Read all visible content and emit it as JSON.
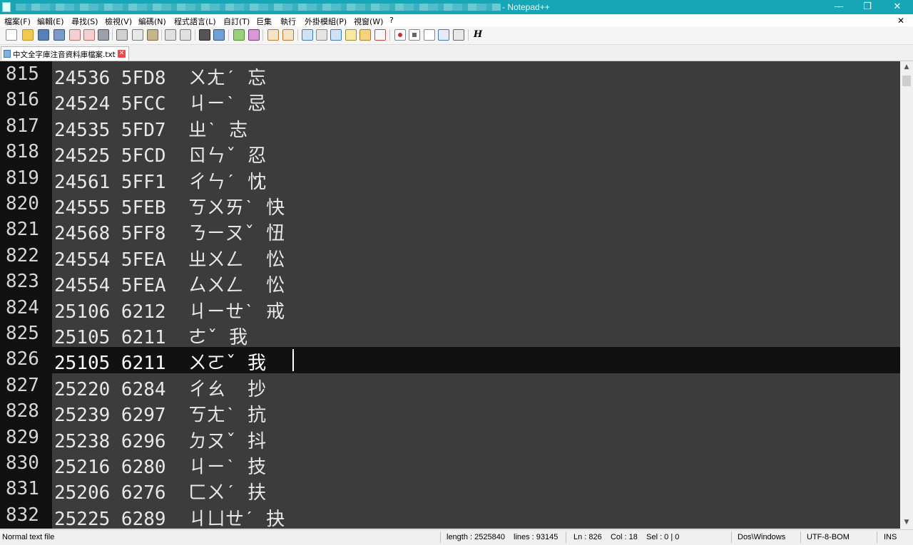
{
  "window": {
    "title": "- Notepad++",
    "minimize_glyph": "—",
    "restore_glyph": "❐",
    "close_glyph": "✕",
    "menu_close_glyph": "✕"
  },
  "menu": [
    "檔案(F)",
    "編輯(E)",
    "尋找(S)",
    "檢視(V)",
    "編碼(N)",
    "程式語言(L)",
    "自訂(T)",
    "巨集",
    "執行",
    "外掛模組(P)",
    "視窗(W)",
    "?"
  ],
  "toolbar": {
    "icons": [
      "new-file-icon",
      "open-file-icon",
      "save-icon",
      "save-all-icon",
      "close-icon",
      "close-all-icon",
      "print-icon",
      "cut-icon",
      "copy-icon",
      "paste-icon",
      "undo-icon",
      "redo-icon",
      "find-icon",
      "replace-icon",
      "zoom-in-icon",
      "zoom-out-icon",
      "sync-vertical-icon",
      "sync-horizontal-icon",
      "word-wrap-icon",
      "show-all-chars-icon",
      "indent-guide-icon",
      "doc-map-icon",
      "function-list-icon",
      "folder-workspace-icon",
      "record-macro-icon",
      "stop-macro-icon",
      "play-macro-icon",
      "run-macro-multiple-icon",
      "save-macro-icon",
      "h-icon"
    ],
    "h_glyph": "H"
  },
  "tab": {
    "label": "中文全字庫注音資料庫檔案.txt",
    "close_glyph": "✕"
  },
  "editor": {
    "current_line": 826,
    "lines": [
      {
        "num": "815",
        "text": "24536 5FD8  ㄨㄤˊ 忘"
      },
      {
        "num": "816",
        "text": "24524 5FCC  ㄐㄧˋ 忌"
      },
      {
        "num": "817",
        "text": "24535 5FD7  ㄓˋ 志"
      },
      {
        "num": "818",
        "text": "24525 5FCD  ㄖㄣˇ 忍"
      },
      {
        "num": "819",
        "text": "24561 5FF1  ㄔㄣˊ 忱"
      },
      {
        "num": "820",
        "text": "24555 5FEB  ㄎㄨㄞˋ 快"
      },
      {
        "num": "821",
        "text": "24568 5FF8  ㄋㄧㄡˇ 忸"
      },
      {
        "num": "822",
        "text": "24554 5FEA  ㄓㄨㄥ  忪"
      },
      {
        "num": "823",
        "text": "24554 5FEA  ㄙㄨㄥ  忪"
      },
      {
        "num": "824",
        "text": "25106 6212  ㄐㄧㄝˋ 戒"
      },
      {
        "num": "825",
        "text": "25105 6211  ㄜˇ 我"
      },
      {
        "num": "826",
        "text": "25105 6211  ㄨㄛˇ 我"
      },
      {
        "num": "827",
        "text": "25220 6284  ㄔㄠ  抄"
      },
      {
        "num": "828",
        "text": "25239 6297  ㄎㄤˋ 抗"
      },
      {
        "num": "829",
        "text": "25238 6296  ㄉㄡˇ 抖"
      },
      {
        "num": "830",
        "text": "25216 6280  ㄐㄧˋ 技"
      },
      {
        "num": "831",
        "text": "25206 6276  ㄈㄨˊ 扶"
      },
      {
        "num": "832",
        "text": "25225 6289  ㄐㄩㄝˊ 抉"
      }
    ]
  },
  "status": {
    "file_type": "Normal text file",
    "length": "length : 2525840",
    "lines": "lines : 93145",
    "position": "Ln : 826    Col : 18    Sel : 0 | 0",
    "eol": "Dos\\Windows",
    "encoding": "UTF-8-BOM",
    "mode": "INS"
  },
  "colors": {
    "titlebar": "#17a6b5",
    "editor_bg": "#3c3c3c",
    "gutter_bg": "#111111",
    "current_line_bg": "#111111"
  }
}
